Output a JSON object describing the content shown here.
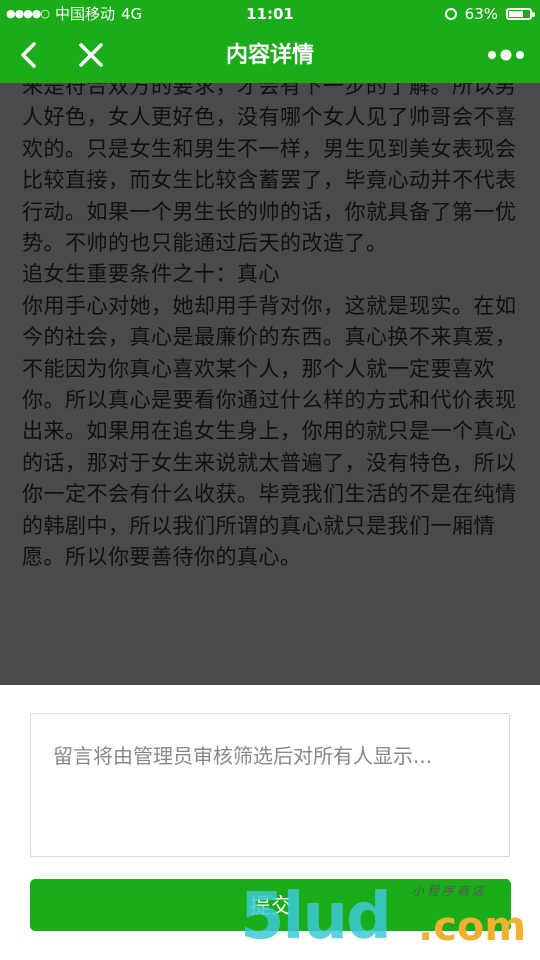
{
  "status_bar": {
    "carrier": "中国移动",
    "network": "4G",
    "time": "11:01",
    "battery": "63%",
    "signal_dots": "●●●●○"
  },
  "nav": {
    "title": "内容详情",
    "back_icon": "chevron-left-icon",
    "close_icon": "close-icon",
    "more_icon": "more-dots-icon"
  },
  "article": {
    "paragraphs": [
      "来是符合双方的要求，才会有下一步的了解。所以男人好色，女人更好色，没有哪个女人见了帅哥会不喜欢的。只是女生和男生不一样，男生见到美女表现会比较直接，而女生比较含蓄罢了，毕竟心动并不代表行动。如果一个男生长的帅的话，你就具备了第一优势。不帅的也只能通过后天的改造了。",
      "追女生重要条件之十：真心",
      "你用手心对她，她却用手背对你，这就是现实。在如今的社会，真心是最廉价的东西。真心换不来真爱，不能因为你真心喜欢某个人，那个人就一定要喜欢你。所以真心是要看你通过什么样的方式和代价表现出来。如果用在追女生身上，你用的就只是一个真心的话，那对于女生来说就太普遍了，没有特色，所以你一定不会有什么收获。毕竟我们生活的不是在纯情的韩剧中，所以我们所谓的真心就只是我们一厢情愿。所以你要善待你的真心。"
    ]
  },
  "comment": {
    "placeholder": "留言将由管理员审核筛选后对所有人显示...",
    "value": "",
    "submit_label": "提交"
  },
  "watermark": {
    "main": "5lud",
    "suffix": ".com",
    "tagline": "小程序商店"
  },
  "colors": {
    "primary_green": "#1aad19",
    "overlay": "#4a4a4a"
  }
}
